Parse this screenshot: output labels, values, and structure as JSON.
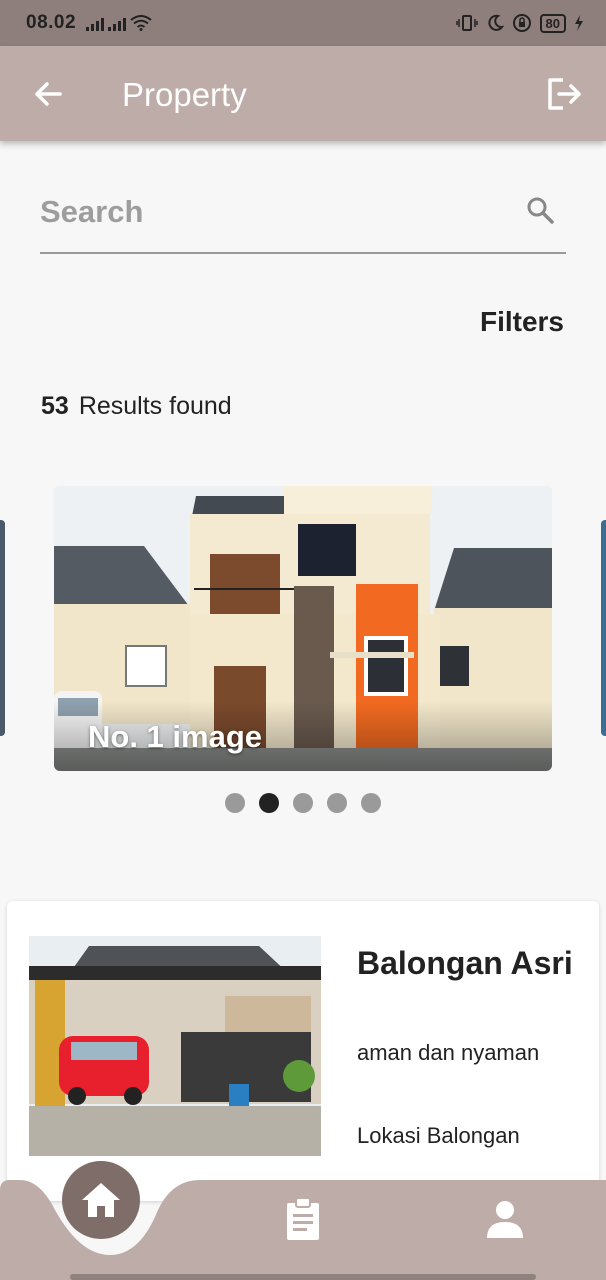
{
  "status_bar": {
    "time": "08.02",
    "battery": "80"
  },
  "app_bar": {
    "title": "Property",
    "back_icon": "arrow-back-icon",
    "logout_icon": "logout-icon"
  },
  "search": {
    "placeholder": "Search",
    "icon": "search-icon"
  },
  "filters_label": "Filters",
  "results": {
    "count": "53",
    "label": "Results found"
  },
  "carousel": {
    "caption": "No. 1 image",
    "total_slides": 5,
    "active_index": 1
  },
  "property_card": {
    "name": "Balongan Asri",
    "description": "aman dan nyaman",
    "location": "Lokasi Balongan"
  },
  "bottom_nav": {
    "items": [
      "home-icon",
      "clipboard-icon",
      "person-icon"
    ],
    "active": "home"
  },
  "colors": {
    "app_bar": "#bdaca7",
    "status_bar": "#8f7f7c",
    "nav_active": "#7f6d69",
    "background": "#f7f7f7"
  }
}
